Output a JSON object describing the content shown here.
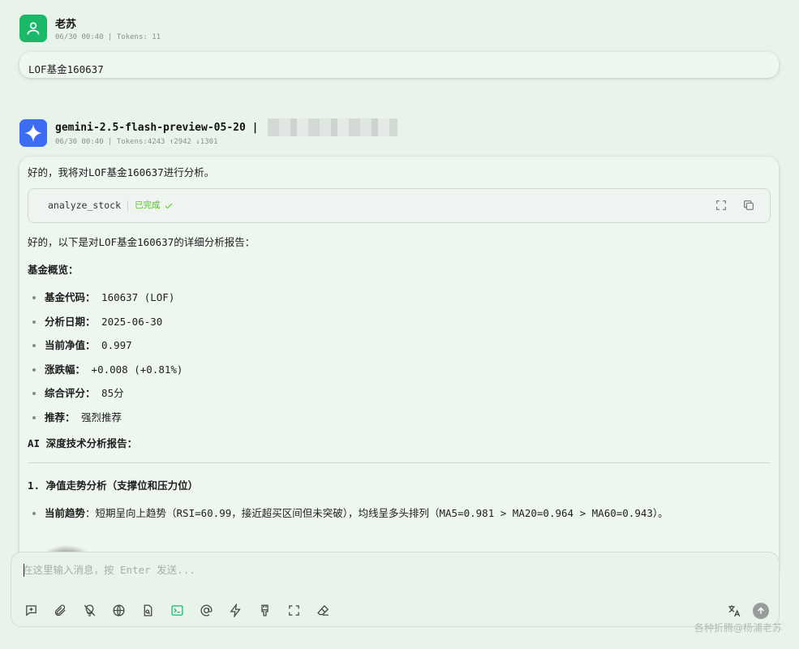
{
  "user_message": {
    "name": "老苏",
    "meta": "06/30 00:40 | Tokens: 11",
    "text": "LOF基金160637"
  },
  "ai_message": {
    "model": "gemini-2.5-flash-preview-05-20 |",
    "meta": "06/30 00:40 | Tokens:4243 ↑2942 ↓1301",
    "intro": "好的，我将对LOF基金160637进行分析。",
    "tool": {
      "name": "analyze_stock",
      "status": "已完成"
    },
    "report_intro": "好的，以下是对LOF基金160637的详细分析报告：",
    "overview_heading": "基金概览：",
    "overview": [
      {
        "label": "基金代码：",
        "value": "160637 (LOF)"
      },
      {
        "label": "分析日期：",
        "value": "2025-06-30"
      },
      {
        "label": "当前净值：",
        "value": "0.997"
      },
      {
        "label": "涨跌幅：",
        "value": "+0.008 (+0.81%)"
      },
      {
        "label": "综合评分：",
        "value": "85分"
      },
      {
        "label": "推荐：",
        "value": "强烈推荐"
      }
    ],
    "ai_heading": "AI 深度技术分析报告：",
    "section1_heading": "1. 净值走势分析（支撑位和压力位）",
    "section1_items": [
      {
        "label": "当前趋势",
        "value": "：短期呈向上趋势（RSI=60.99，接近超买区间但未突破），均线呈多头排列（MA5=0.981 > MA20=0.964 > MA60=0.943）。"
      }
    ]
  },
  "input": {
    "placeholder": "在这里输入消息，按 Enter 发送..."
  },
  "toolbar_icons": [
    "new-topic-icon",
    "attachment-icon",
    "no-thinking-icon",
    "web-search-icon",
    "knowledge-icon",
    "mcp-terminal-icon",
    "mention-icon",
    "quick-phrase-icon",
    "clear-brush-icon",
    "fullscreen-icon",
    "eraser-icon"
  ],
  "watermark": "各种折腾@杨浦老苏",
  "colors": {
    "background": "#e8f3ea",
    "user_avatar": "#1cb86a",
    "ai_avatar": "#3b6cf4",
    "status_green": "#52c41a"
  }
}
